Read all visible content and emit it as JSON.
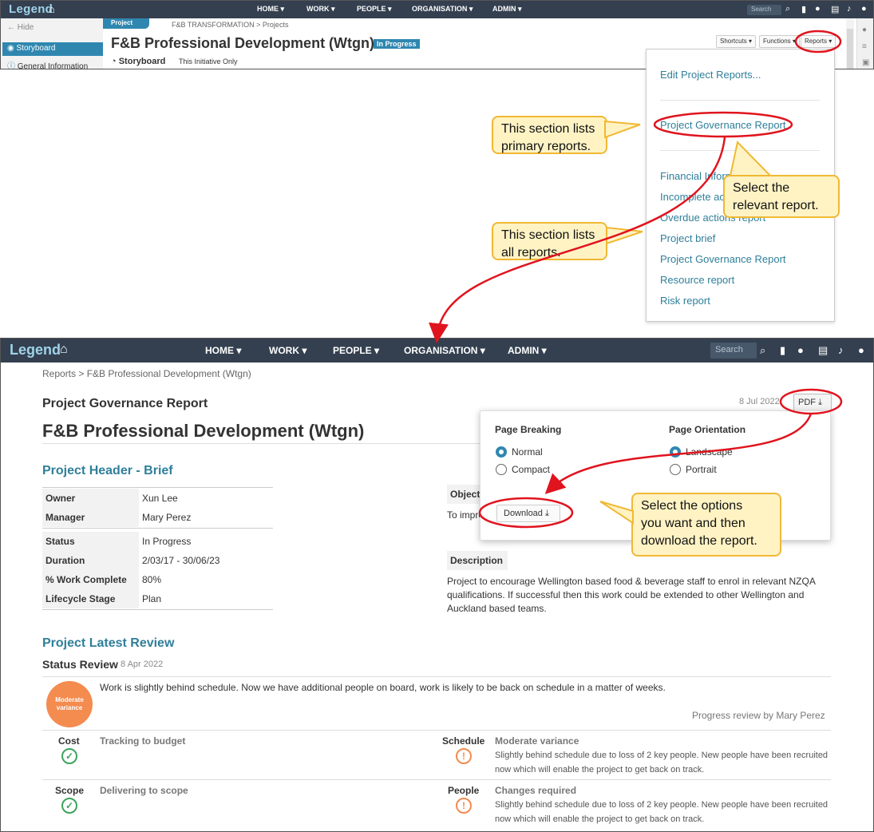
{
  "top": {
    "logo": "Legend",
    "nav": [
      "HOME ▾",
      "WORK ▾",
      "PEOPLE ▾",
      "ORGANISATION ▾",
      "ADMIN ▾"
    ],
    "search_placeholder": "Search",
    "hide_label": "Hide",
    "sidebar_active": "Storyboard",
    "sidebar_item": "General Information",
    "project_tab": "Project",
    "breadcrumb": "F&B TRANSFORMATION > Projects",
    "title": "F&B Professional Development (Wtgn)",
    "status_badge": "In Progress",
    "storyboard_label": "Storyboard",
    "scope_label": "This Initiative Only",
    "shortcuts": "Shortcuts ▾",
    "functions": "Functions ▾",
    "reports": "Reports ▾"
  },
  "dropdown": {
    "edit": "Edit Project Reports...",
    "primary": [
      "Project Governance Report"
    ],
    "all": [
      "Financial Inform",
      "Incomplete ac",
      "Overdue actions report",
      "Project brief",
      "Project Governance Report",
      "Resource report",
      "Risk report"
    ]
  },
  "callouts": {
    "primary": [
      "This section lists",
      "primary reports."
    ],
    "select": [
      "Select the",
      "relevant report."
    ],
    "all": [
      "This section lists",
      "all reports."
    ],
    "options": [
      "Select the options",
      "you want and then",
      "download the report."
    ]
  },
  "bottom": {
    "logo": "Legend",
    "nav": [
      "HOME ▾",
      "WORK ▾",
      "PEOPLE ▾",
      "ORGANISATION ▾",
      "ADMIN ▾"
    ],
    "search_placeholder": "Search",
    "breadcrumb": "Reports > F&B Professional Development (Wtgn)",
    "report_title": "Project Governance Report",
    "date": "8 Jul 2022",
    "pdf_label": "PDF",
    "project_title": "F&B Professional Development (Wtgn)",
    "header_section": "Project Header - Brief",
    "fields": [
      {
        "k": "Owner",
        "v": "Xun Lee"
      },
      {
        "k": "Manager",
        "v": "Mary Perez"
      },
      {
        "k": "Status",
        "v": " In Progress"
      },
      {
        "k": "Duration",
        "v": "2/03/17 - 30/06/23"
      },
      {
        "k": "% Work Complete",
        "v": "80%"
      },
      {
        "k": "Lifecycle Stage",
        "v": "Plan"
      }
    ],
    "objective_label": "Object",
    "objective_text": "To impro",
    "description_label": "Description",
    "description_text": "Project to encourage Wellington based food & beverage staff to enrol in relevant NZQA qualifications. If successful then this work could be extended to other Wellington and Auckland based teams.",
    "review_section": "Project Latest Review",
    "status_review": "Status Review",
    "status_review_date": "8 Apr 2022",
    "variance_badge": "Moderate variance",
    "review_text": "Work is slightly behind schedule. Now we have additional people on board, work is likely to be back on schedule in a matter of weeks.",
    "reviewer": "Progress review by Mary Perez",
    "metrics": [
      {
        "label": "Cost",
        "value": "Tracking to budget",
        "status": "ok"
      },
      {
        "label": "Schedule",
        "value": "Moderate variance",
        "status": "warn",
        "desc": "Slightly behind schedule due to loss of 2 key people.  New people have been recruited now which will enable the project to get back on track."
      },
      {
        "label": "Scope",
        "value": "Delivering to scope",
        "status": "ok"
      },
      {
        "label": "People",
        "value": "Changes required",
        "status": "warn",
        "desc": "Slightly behind schedule due to loss of 2 key people.  New people have been recruited now which will enable the project to get back on track."
      }
    ]
  },
  "pdf_popup": {
    "page_breaking": "Page Breaking",
    "page_orientation": "Page Orientation",
    "breaking_options": [
      "Normal",
      "Compact"
    ],
    "orientation_options": [
      "Landscape",
      "Portrait"
    ],
    "selected_breaking": "Normal",
    "selected_orientation": "Landscape",
    "download": "Download"
  },
  "colors": {
    "nav_bg": "#344050",
    "accent": "#2f87b0",
    "link": "#2f7f9a",
    "highlight": "#e0141e",
    "callout_bg": "#fff3c4",
    "callout_border": "#f0b834",
    "variance": "#f48b4f",
    "ok": "#3da35d"
  }
}
